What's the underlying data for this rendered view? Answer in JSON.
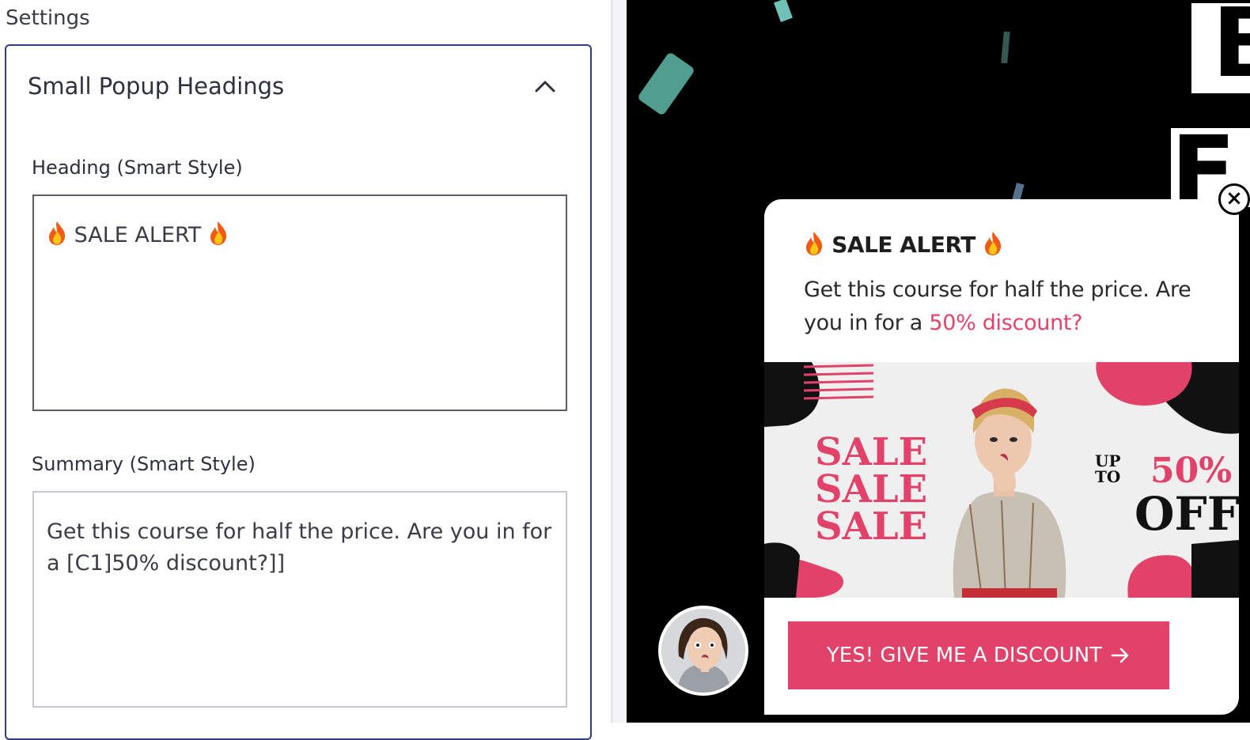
{
  "settings": {
    "title": "Settings",
    "section_title": "Small Popup Headings",
    "heading_label": "Heading (Smart Style)",
    "heading_value": "SALE ALERT",
    "summary_label": "Summary (Smart Style)",
    "summary_value": "Get this course for half the price. Are you in for a [C1]50% discount?]]"
  },
  "popup": {
    "heading": "SALE ALERT",
    "summary_text": "Get this course for half the price. Are you in for a ",
    "summary_highlight": "50% discount?",
    "highlight_color": "#e5416b",
    "banner": {
      "sale_lines": [
        "SALE",
        "SALE",
        "SALE"
      ],
      "up_to": [
        "UP",
        "TO"
      ],
      "percent": "50%",
      "off": "OFF"
    },
    "cta_label": "YES! GIVE ME A DISCOUNT",
    "cta_color": "#e2416a",
    "close_label": "×",
    "icons": [
      "fire-icon",
      "chevron-up-icon",
      "close-icon",
      "arrow-right-icon"
    ]
  },
  "background_letters": [
    "B",
    "F"
  ]
}
